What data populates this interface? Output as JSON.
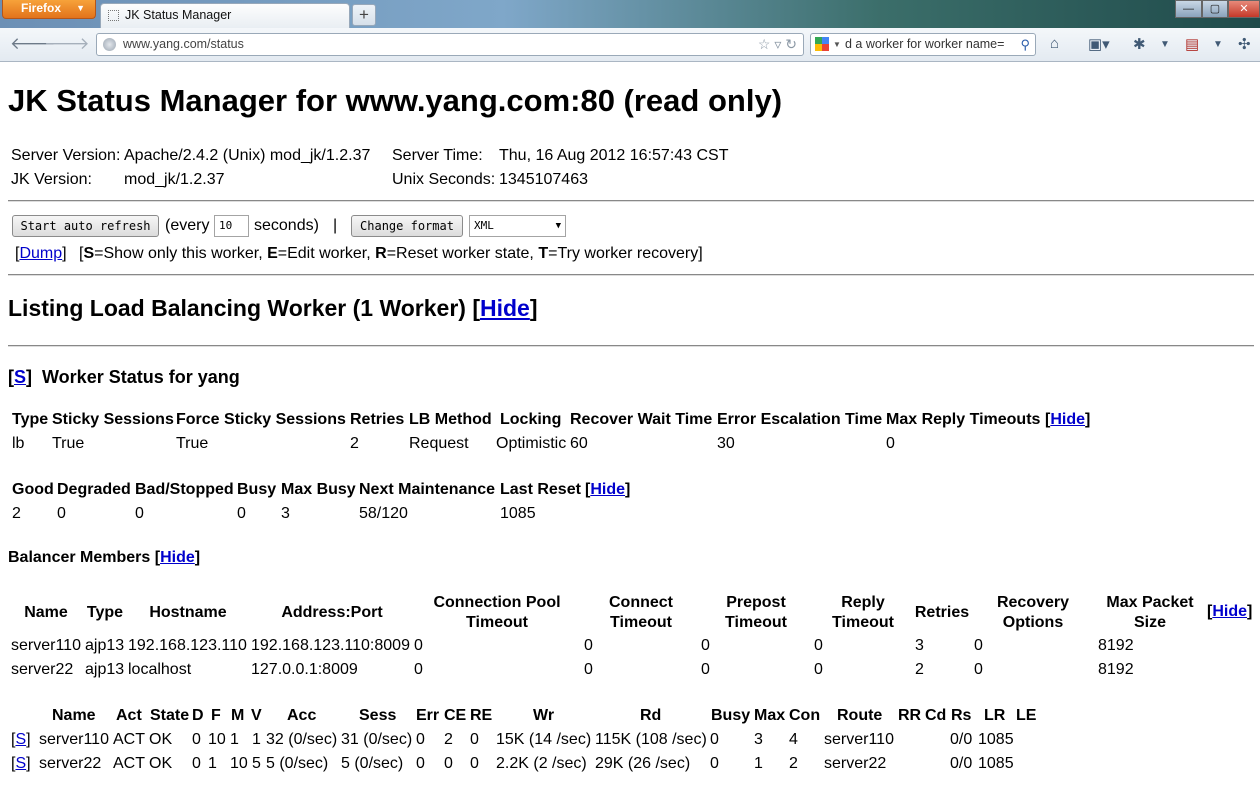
{
  "browser": {
    "menu_button": "Firefox",
    "tab_title": "JK Status Manager",
    "new_tab": "+",
    "url": "www.yang.com/status",
    "search_text": "d a worker for worker name=",
    "win_min": "—",
    "win_max": "▢",
    "win_close": "✕"
  },
  "page": {
    "title": "JK Status Manager for www.yang.com:80 (read only)",
    "server_version_label": "Server Version:",
    "server_version": "Apache/2.4.2 (Unix) mod_jk/1.2.37",
    "jk_version_label": "JK Version:",
    "jk_version": "mod_jk/1.2.37",
    "server_time_label": "Server Time:",
    "server_time": "Thu, 16 Aug 2012 16:57:43 CST",
    "unix_seconds_label": "Unix Seconds:",
    "unix_seconds": "1345107463",
    "auto_refresh_button": "Start auto refresh",
    "every_label": "(every",
    "refresh_seconds": "10",
    "seconds_label": "seconds)",
    "pipe": "|",
    "change_format_button": "Change format",
    "format_selected": "XML",
    "dump_link": "Dump",
    "legend_S": "S",
    "legend_S_text": "=Show only this worker, ",
    "legend_E": "E",
    "legend_E_text": "=Edit worker, ",
    "legend_R": "R",
    "legend_R_text": "=Reset worker state, ",
    "legend_T": "T",
    "legend_T_text": "=Try worker recovery]",
    "section_title": "Listing Load Balancing Worker (1 Worker) [",
    "hide": "Hide",
    "worker_show": "S",
    "worker_status_title": "Worker Status for yang",
    "balancer_members_title": "Balancer Members ["
  },
  "lb_table": {
    "headers": [
      "Type",
      "Sticky Sessions",
      "Force Sticky Sessions",
      "Retries",
      "LB Method",
      "Locking",
      "Recover Wait Time",
      "Error Escalation Time",
      "Max Reply Timeouts"
    ],
    "row": [
      "lb",
      "True",
      "True",
      "2",
      "Request",
      "Optimistic",
      "60",
      "30",
      "0"
    ]
  },
  "state_table": {
    "headers": [
      "Good",
      "Degraded",
      "Bad/Stopped",
      "Busy",
      "Max Busy",
      "Next Maintenance",
      "Last Reset"
    ],
    "row": [
      "2",
      "0",
      "0",
      "0",
      "3",
      "58/120",
      "1085"
    ]
  },
  "members_table": {
    "headers": [
      "Name",
      "Type",
      "Hostname",
      "Address:Port",
      "Connection Pool Timeout",
      "Connect Timeout",
      "Prepost Timeout",
      "Reply Timeout",
      "Retries",
      "Recovery Options",
      "Max Packet Size"
    ],
    "rows": [
      [
        "server110",
        "ajp13",
        "192.168.123.110",
        "192.168.123.110:8009",
        "0",
        "0",
        "0",
        "0",
        "3",
        "0",
        "8192"
      ],
      [
        "server22",
        "ajp13",
        "localhost",
        "127.0.0.1:8009",
        "0",
        "0",
        "0",
        "0",
        "2",
        "0",
        "8192"
      ]
    ]
  },
  "stats_table": {
    "headers": [
      "Name",
      "Act",
      "State",
      "D",
      "F",
      "M",
      "V",
      "Acc",
      "Sess",
      "Err",
      "CE",
      "RE",
      "Wr",
      "Rd",
      "Busy",
      "Max",
      "Con",
      "Route",
      "RR",
      "Cd",
      "Rs",
      "LR",
      "LE"
    ],
    "rows": [
      [
        "server110",
        "ACT",
        "OK",
        "0",
        "10",
        "1",
        "1",
        "32 (0/sec)",
        "31 (0/sec)",
        "0",
        "2",
        "0",
        "15K (14 /sec)",
        "115K (108 /sec)",
        "0",
        "3",
        "4",
        "server110",
        "",
        "",
        "0/0",
        "1085",
        ""
      ],
      [
        "server22",
        "ACT",
        "OK",
        "0",
        "1",
        "10",
        "5",
        "5 (0/sec)",
        "5 (0/sec)",
        "0",
        "0",
        "0",
        "2.2K (2 /sec)",
        "29K (26 /sec)",
        "0",
        "1",
        "2",
        "server22",
        "",
        "",
        "0/0",
        "1085",
        ""
      ]
    ]
  }
}
